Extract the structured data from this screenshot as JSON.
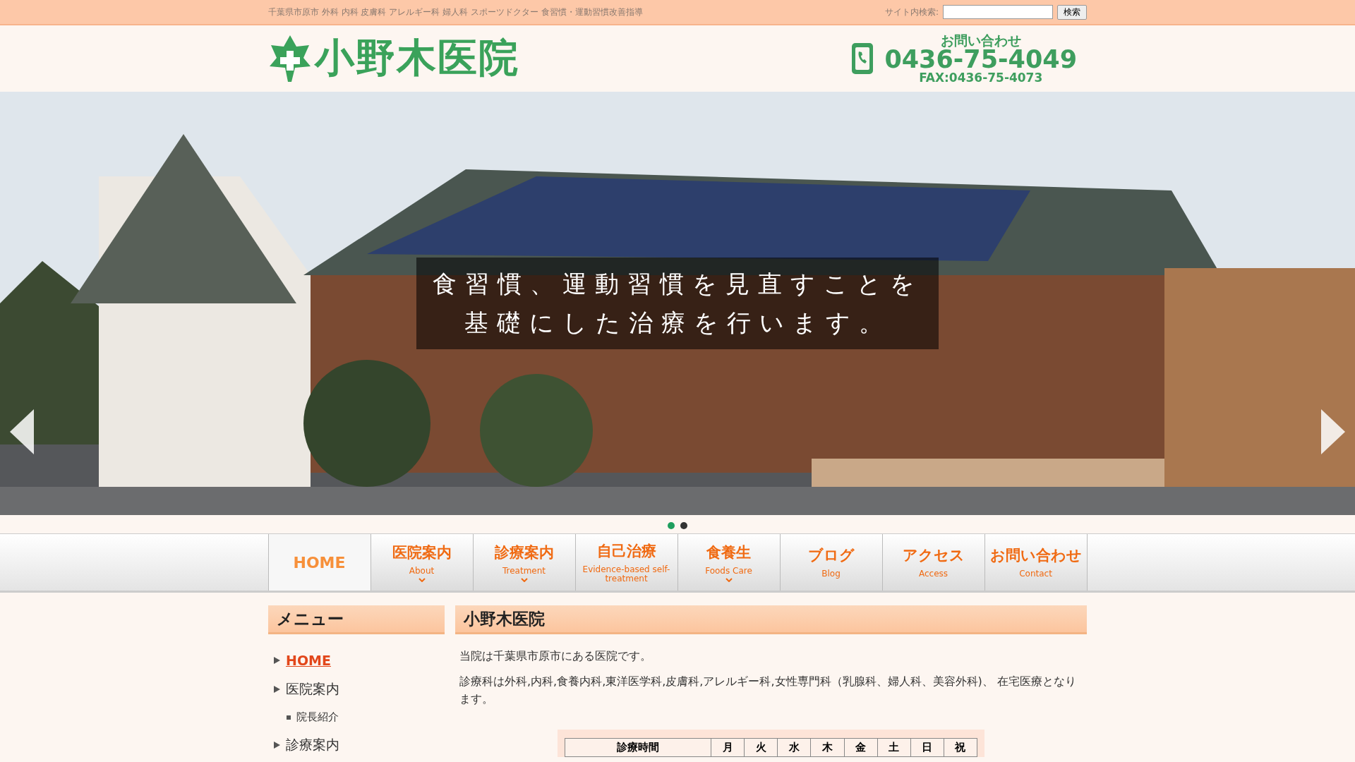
{
  "top_bar": {
    "tagline": "千葉県市原市 外科 内科 皮膚科 アレルギー科 婦人科 スポーツドクター 食習慣・運動習慣改善指導",
    "search_label": "サイト内検索:",
    "search_button": "検索"
  },
  "header": {
    "logo": "小野木医院",
    "contact_title": "お問い合わせ",
    "phone": "0436-75-4049",
    "fax": "FAX:0436-75-4073"
  },
  "slider": {
    "caption_lines": [
      "食習慣、運動習慣を見直すことを",
      "基礎にした治療を行います。"
    ],
    "dots": [
      {
        "selected": true
      },
      {
        "selected": false
      }
    ]
  },
  "nav": [
    {
      "label": "HOME",
      "has_submenu": false,
      "kind": "latin",
      "selected": true
    },
    {
      "label": "医院案内",
      "sub": "About",
      "has_submenu": true,
      "kind": "jp",
      "selected": false
    },
    {
      "label": "診療案内",
      "sub": "Treatment",
      "has_submenu": true,
      "kind": "jp",
      "selected": false
    },
    {
      "label": "自己治療",
      "sub": "Evidence-based self-treatment",
      "has_submenu": false,
      "kind": "jp",
      "selected": false
    },
    {
      "label": "食養生",
      "sub": "Foods Care",
      "has_submenu": true,
      "kind": "jp",
      "selected": false
    },
    {
      "label": "ブログ",
      "sub": "Blog",
      "has_submenu": false,
      "kind": "jp",
      "selected": false
    },
    {
      "label": "アクセス",
      "sub": "Access",
      "has_submenu": false,
      "kind": "jp",
      "selected": false
    },
    {
      "label": "お問い合わせ",
      "sub": "Contact",
      "has_submenu": false,
      "kind": "jp",
      "selected": false
    }
  ],
  "sidebar": {
    "title": "メニュー",
    "items": [
      {
        "label": "HOME",
        "selected": true
      },
      {
        "label": "医院案内",
        "selected": false,
        "children": [
          {
            "label": "院長紹介",
            "selected": false
          }
        ]
      },
      {
        "label": "診療案内",
        "selected": false
      }
    ]
  },
  "main": {
    "title": "小野木医院",
    "paragraphs": [
      "当院は千葉県市原市にある医院です。",
      "診療科は外科,内科,食養内科,東洋医学科,皮膚科,アレルギー科,女性専門科（乳腺科、婦人科、美容外科)、 在宅医療となります。"
    ],
    "table": {
      "columns": [
        "診療時間",
        "月",
        "火",
        "水",
        "木",
        "金",
        "土",
        "日",
        "祝"
      ]
    }
  }
}
